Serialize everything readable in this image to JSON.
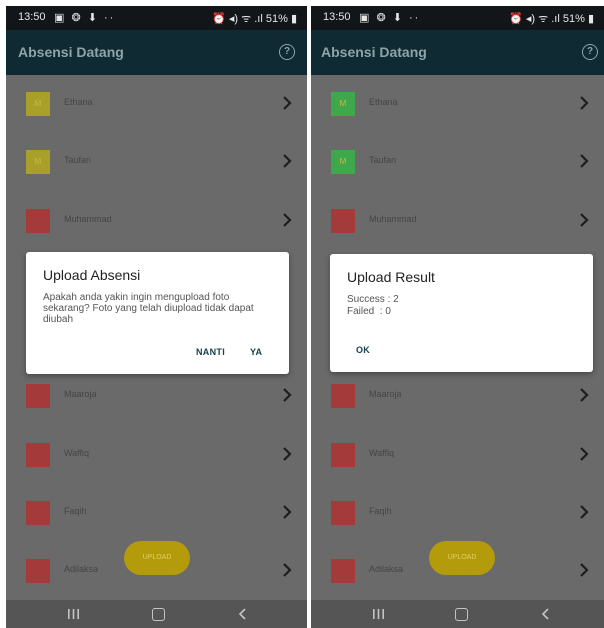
{
  "status_bar": {
    "time": "13:50",
    "left_icons": "▣ ❂ ⬇ ··",
    "right_icons": "⏰ ◂) ᯤ .ıl",
    "battery": "51%"
  },
  "app_bar": {
    "title": "Absensi Datang",
    "help_icon": "question-circle-icon",
    "help_glyph": "?"
  },
  "colors": {
    "status_bar": "#131619",
    "app_bar": "#0f2a32",
    "overlay": "#6a6a6a",
    "uploaded_square_left": "#a9a02a",
    "uploaded_square_right": "#3ea84a",
    "pending_square": "#a43a3a",
    "upload_button": "#b39b0c",
    "dialog_button_text": "#16414d"
  },
  "left_screen": {
    "rows": [
      {
        "name": "Ethana",
        "badge": "M",
        "status": "uploaded"
      },
      {
        "name": "Taufan",
        "badge": "M",
        "status": "uploaded"
      },
      {
        "name": "Muhammad",
        "badge": "",
        "status": "pending"
      },
      {
        "name": "Maaroja",
        "badge": "",
        "status": "pending"
      },
      {
        "name": "Waffiq",
        "badge": "",
        "status": "pending"
      },
      {
        "name": "Faqih",
        "badge": "",
        "status": "pending"
      },
      {
        "name": "Adilaksa",
        "badge": "",
        "status": "pending"
      }
    ],
    "upload_button": "UPLOAD",
    "dialog": {
      "title": "Upload Absensi",
      "message": "Apakah anda yakin ingin mengupload foto sekarang? Foto yang telah diupload tidak dapat diubah",
      "negative": "NANTI",
      "positive": "YA"
    }
  },
  "right_screen": {
    "rows": [
      {
        "name": "Ethana",
        "badge": "M",
        "status": "uploaded"
      },
      {
        "name": "Taufan",
        "badge": "M",
        "status": "uploaded"
      },
      {
        "name": "Muhammad",
        "badge": "",
        "status": "pending"
      },
      {
        "name": "Maaroja",
        "badge": "",
        "status": "pending"
      },
      {
        "name": "Waffiq",
        "badge": "",
        "status": "pending"
      },
      {
        "name": "Faqih",
        "badge": "",
        "status": "pending"
      },
      {
        "name": "Adilaksa",
        "badge": "",
        "status": "pending"
      }
    ],
    "upload_button": "UPLOAD",
    "dialog": {
      "title": "Upload Result",
      "success": "Success : 2",
      "failed": "Failed  : 0",
      "ok": "OK"
    }
  },
  "nav_bar": {
    "recents_icon": "recents-icon",
    "home_icon": "home-icon",
    "back_icon": "back-icon"
  }
}
